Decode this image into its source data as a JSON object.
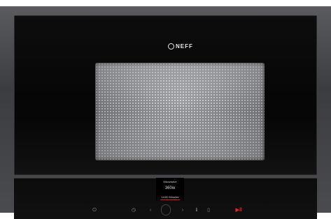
{
  "brand": {
    "logo_text": "NEFF"
  },
  "display": {
    "mode": "Microwave",
    "power": "360w",
    "time": "14:00 Minutes"
  },
  "controls": {
    "power_icon": "power-icon",
    "timer_icon": "timer-icon",
    "left_icon": "chevron-left-icon",
    "right_icon": "chevron-right-icon",
    "info_icon": "info-icon",
    "menu_icon": "menu-icon",
    "start_stop_icon": "start-stop-icon",
    "power_symbol": "⏻",
    "timer_symbol": "◷",
    "left_symbol": "‹",
    "right_symbol": "›",
    "info_symbol": "ℹ",
    "menu_symbol": "▯",
    "start_symbol": "▶‖"
  },
  "colors": {
    "accent_red": "#e02a2a",
    "door_black": "#050505",
    "frame_gray": "#4a4b4e"
  }
}
